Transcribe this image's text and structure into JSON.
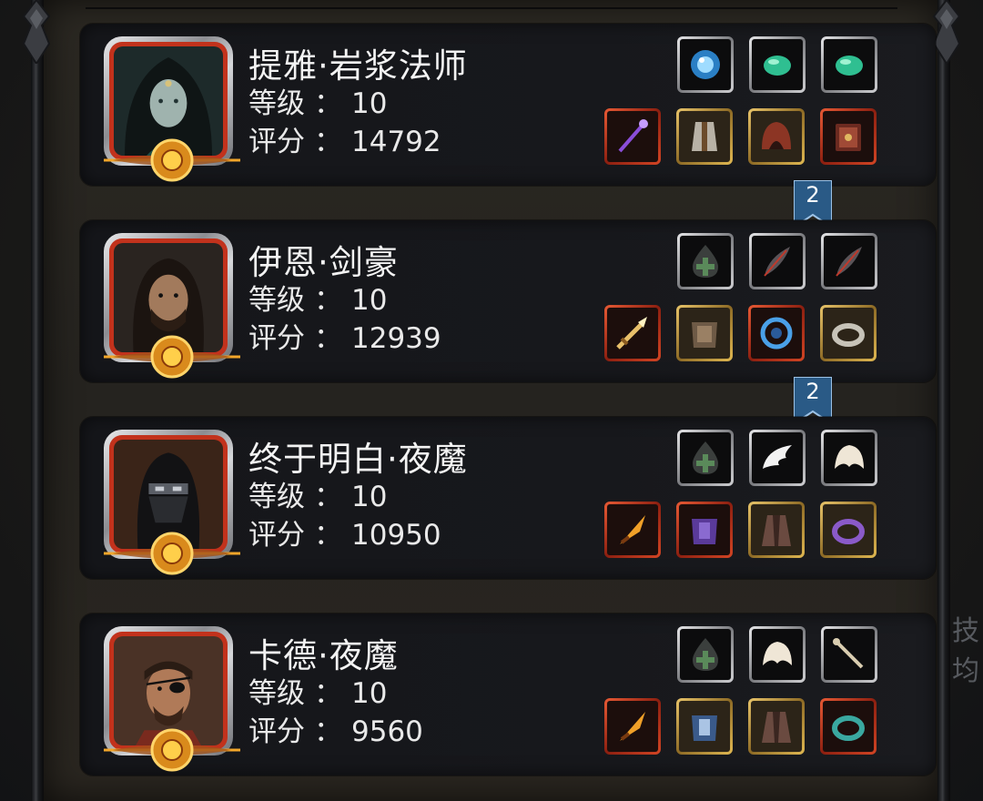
{
  "side_text": "技均",
  "labels": {
    "level": "等级",
    "score": "评分",
    "colon": "："
  },
  "heroes": [
    {
      "name": "提雅·岩浆法师",
      "level": "10",
      "score": "14792",
      "accessories": [
        {
          "icon": "blue-orb-icon",
          "frame": "silver"
        },
        {
          "icon": "green-gem-icon",
          "frame": "silver"
        },
        {
          "icon": "green-gem-icon",
          "frame": "silver"
        }
      ],
      "equipment": [
        {
          "icon": "purple-staff-icon",
          "frame": "red"
        },
        {
          "icon": "robe-armor-icon",
          "frame": "gold"
        },
        {
          "icon": "hood-icon",
          "frame": "gold"
        },
        {
          "icon": "spellbook-icon",
          "frame": "red"
        }
      ]
    },
    {
      "name": "伊恩·剑豪",
      "level": "10",
      "score": "12939",
      "accessories": [
        {
          "icon": "empty-potion-slot-icon",
          "frame": "silver"
        },
        {
          "icon": "dark-feather-icon",
          "frame": "silver"
        },
        {
          "icon": "dark-feather-icon",
          "frame": "silver"
        }
      ],
      "equipment": [
        {
          "icon": "golden-sword-icon",
          "frame": "red"
        },
        {
          "icon": "plate-armor-icon",
          "frame": "gold"
        },
        {
          "icon": "blue-shield-icon",
          "frame": "red"
        },
        {
          "icon": "silver-ring-icon",
          "frame": "gold"
        }
      ]
    },
    {
      "name": "终于明白·夜魔",
      "level": "10",
      "score": "10950",
      "accessories": [
        {
          "icon": "empty-potion-slot-icon",
          "frame": "silver"
        },
        {
          "icon": "white-wing-icon",
          "frame": "silver"
        },
        {
          "icon": "white-fur-icon",
          "frame": "silver"
        }
      ],
      "equipment": [
        {
          "icon": "flame-dagger-icon",
          "frame": "red"
        },
        {
          "icon": "purple-armor-icon",
          "frame": "red"
        },
        {
          "icon": "cloak-icon",
          "frame": "gold"
        },
        {
          "icon": "purple-ring-icon",
          "frame": "gold"
        }
      ]
    },
    {
      "name": "卡德·夜魔",
      "level": "10",
      "score": "9560",
      "accessories": [
        {
          "icon": "empty-potion-slot-icon",
          "frame": "silver"
        },
        {
          "icon": "white-fur-icon",
          "frame": "silver"
        },
        {
          "icon": "bone-wand-icon",
          "frame": "silver"
        }
      ],
      "equipment": [
        {
          "icon": "flame-dagger-icon",
          "frame": "red"
        },
        {
          "icon": "blue-armor-icon",
          "frame": "gold"
        },
        {
          "icon": "cloak-icon",
          "frame": "gold"
        },
        {
          "icon": "teal-ring-icon",
          "frame": "red"
        }
      ]
    }
  ],
  "rank_badges": [
    "2",
    "2"
  ],
  "colors": {
    "frame_red": "#c2321c",
    "frame_gold": "#c9a04a",
    "frame_silver": "#bfc0c3",
    "text": "#f3f3f3",
    "ribbon": "#2a5a86"
  }
}
